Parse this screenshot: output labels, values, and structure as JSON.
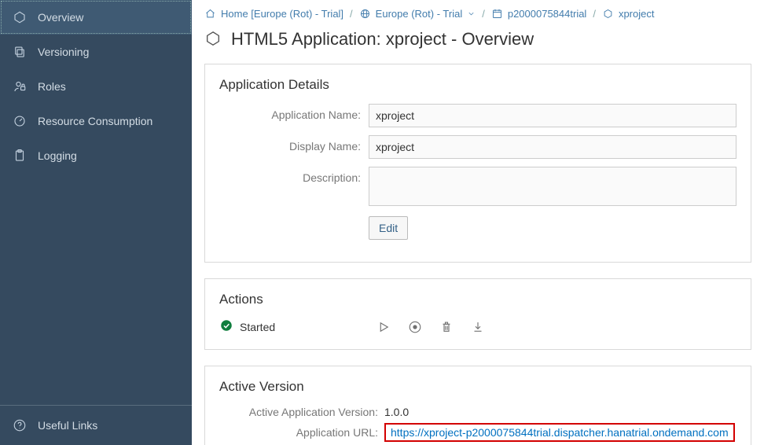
{
  "sidebar": {
    "items": [
      {
        "label": "Overview"
      },
      {
        "label": "Versioning"
      },
      {
        "label": "Roles"
      },
      {
        "label": "Resource Consumption"
      },
      {
        "label": "Logging"
      }
    ],
    "footer": {
      "label": "Useful Links"
    }
  },
  "breadcrumb": {
    "items": [
      {
        "label": "Home [Europe (Rot) - Trial]"
      },
      {
        "label": "Europe (Rot) - Trial"
      },
      {
        "label": "p2000075844trial"
      },
      {
        "label": "xproject"
      }
    ]
  },
  "page": {
    "title": "HTML5 Application: xproject - Overview"
  },
  "details": {
    "heading": "Application Details",
    "labels": {
      "appName": "Application Name:",
      "displayName": "Display Name:",
      "description": "Description:"
    },
    "values": {
      "appName": "xproject",
      "displayName": "xproject",
      "description": ""
    },
    "editButton": "Edit"
  },
  "actions": {
    "heading": "Actions",
    "statusText": "Started"
  },
  "activeVersion": {
    "heading": "Active Version",
    "labels": {
      "version": "Active Application Version:",
      "url": "Application URL:"
    },
    "values": {
      "version": "1.0.0",
      "url": "https://xproject-p2000075844trial.dispatcher.hanatrial.ondemand.com"
    }
  }
}
